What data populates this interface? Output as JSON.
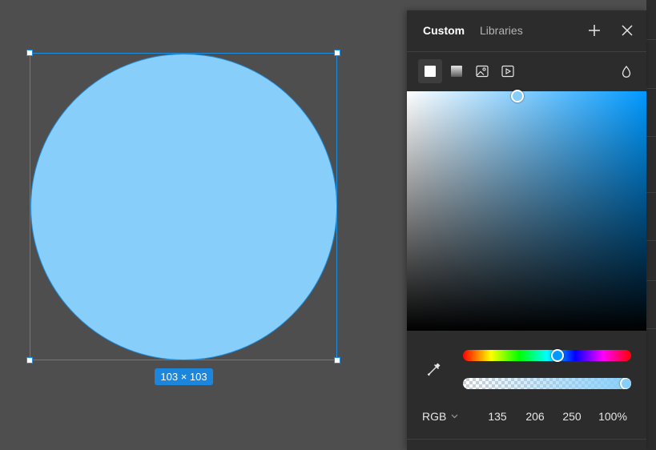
{
  "canvas": {
    "shape": {
      "type": "ellipse",
      "fill": "#87cefa",
      "stroke": "#1e8fe0"
    },
    "selection_color": "#1e8fe0",
    "size_label": "103 × 103"
  },
  "color_picker": {
    "tabs": [
      {
        "label": "Custom",
        "active": true
      },
      {
        "label": "Libraries",
        "active": false
      }
    ],
    "header_icons": [
      "add-icon",
      "close-icon"
    ],
    "fill_types": [
      {
        "icon": "solid-fill-icon",
        "active": true
      },
      {
        "icon": "gradient-fill-icon",
        "active": false
      },
      {
        "icon": "image-fill-icon",
        "active": false
      },
      {
        "icon": "video-fill-icon",
        "active": false
      }
    ],
    "blend_icon": "drop-icon",
    "hue_color": "#0099ff",
    "saturation": 0.46,
    "brightness": 0.98,
    "hue_fraction": 0.56,
    "alpha_fraction": 1.0,
    "color_hex": "#87cefa",
    "eyedropper_icon": "eyedropper-icon",
    "mode": "RGB",
    "r": "135",
    "g": "206",
    "b": "250",
    "alpha": "100%"
  }
}
